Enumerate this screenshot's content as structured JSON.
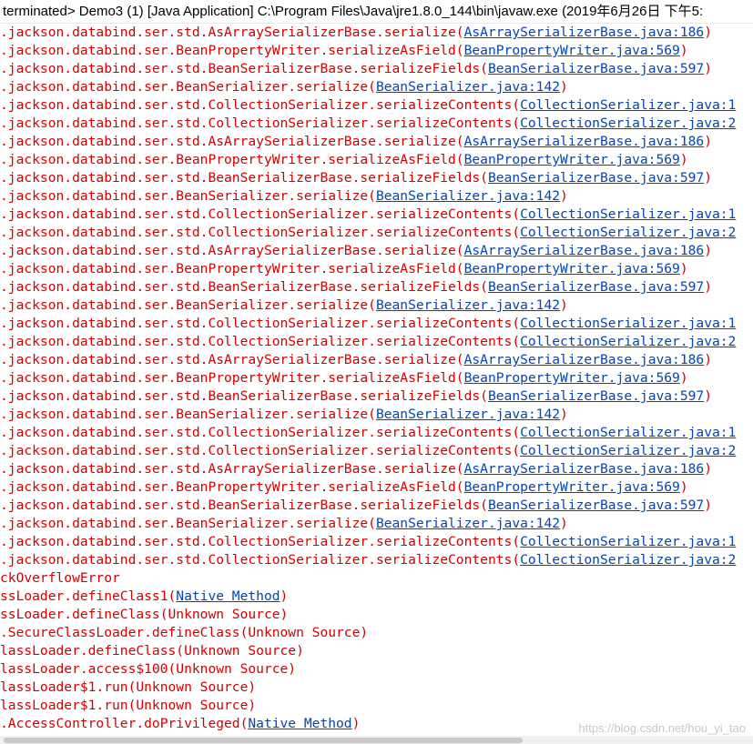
{
  "console": {
    "title": "terminated> Demo3 (1) [Java Application] C:\\Program Files\\Java\\jre1.8.0_144\\bin\\javaw.exe (2019年6月26日 下午5:",
    "watermark": "https://blog.csdn.net/hou_yi_tao",
    "lines": [
      {
        "text": ".jackson.databind.ser.std.AsArraySerializerBase.serialize(",
        "link": "AsArraySerializerBase.java:186",
        "suffix": ")"
      },
      {
        "text": ".jackson.databind.ser.BeanPropertyWriter.serializeAsField(",
        "link": "BeanPropertyWriter.java:569",
        "suffix": ")"
      },
      {
        "text": ".jackson.databind.ser.std.BeanSerializerBase.serializeFields(",
        "link": "BeanSerializerBase.java:597",
        "suffix": ")"
      },
      {
        "text": ".jackson.databind.ser.BeanSerializer.serialize(",
        "link": "BeanSerializer.java:142",
        "suffix": ")"
      },
      {
        "text": ".jackson.databind.ser.std.CollectionSerializer.serializeContents(",
        "link": "CollectionSerializer.java:1",
        "suffix": ""
      },
      {
        "text": ".jackson.databind.ser.std.CollectionSerializer.serializeContents(",
        "link": "CollectionSerializer.java:2",
        "suffix": ""
      },
      {
        "text": ".jackson.databind.ser.std.AsArraySerializerBase.serialize(",
        "link": "AsArraySerializerBase.java:186",
        "suffix": ")"
      },
      {
        "text": ".jackson.databind.ser.BeanPropertyWriter.serializeAsField(",
        "link": "BeanPropertyWriter.java:569",
        "suffix": ")"
      },
      {
        "text": ".jackson.databind.ser.std.BeanSerializerBase.serializeFields(",
        "link": "BeanSerializerBase.java:597",
        "suffix": ")"
      },
      {
        "text": ".jackson.databind.ser.BeanSerializer.serialize(",
        "link": "BeanSerializer.java:142",
        "suffix": ")"
      },
      {
        "text": ".jackson.databind.ser.std.CollectionSerializer.serializeContents(",
        "link": "CollectionSerializer.java:1",
        "suffix": ""
      },
      {
        "text": ".jackson.databind.ser.std.CollectionSerializer.serializeContents(",
        "link": "CollectionSerializer.java:2",
        "suffix": ""
      },
      {
        "text": ".jackson.databind.ser.std.AsArraySerializerBase.serialize(",
        "link": "AsArraySerializerBase.java:186",
        "suffix": ")"
      },
      {
        "text": ".jackson.databind.ser.BeanPropertyWriter.serializeAsField(",
        "link": "BeanPropertyWriter.java:569",
        "suffix": ")"
      },
      {
        "text": ".jackson.databind.ser.std.BeanSerializerBase.serializeFields(",
        "link": "BeanSerializerBase.java:597",
        "suffix": ")"
      },
      {
        "text": ".jackson.databind.ser.BeanSerializer.serialize(",
        "link": "BeanSerializer.java:142",
        "suffix": ")"
      },
      {
        "text": ".jackson.databind.ser.std.CollectionSerializer.serializeContents(",
        "link": "CollectionSerializer.java:1",
        "suffix": ""
      },
      {
        "text": ".jackson.databind.ser.std.CollectionSerializer.serializeContents(",
        "link": "CollectionSerializer.java:2",
        "suffix": ""
      },
      {
        "text": ".jackson.databind.ser.std.AsArraySerializerBase.serialize(",
        "link": "AsArraySerializerBase.java:186",
        "suffix": ")"
      },
      {
        "text": ".jackson.databind.ser.BeanPropertyWriter.serializeAsField(",
        "link": "BeanPropertyWriter.java:569",
        "suffix": ")"
      },
      {
        "text": ".jackson.databind.ser.std.BeanSerializerBase.serializeFields(",
        "link": "BeanSerializerBase.java:597",
        "suffix": ")"
      },
      {
        "text": ".jackson.databind.ser.BeanSerializer.serialize(",
        "link": "BeanSerializer.java:142",
        "suffix": ")"
      },
      {
        "text": ".jackson.databind.ser.std.CollectionSerializer.serializeContents(",
        "link": "CollectionSerializer.java:1",
        "suffix": ""
      },
      {
        "text": ".jackson.databind.ser.std.CollectionSerializer.serializeContents(",
        "link": "CollectionSerializer.java:2",
        "suffix": ""
      },
      {
        "text": ".jackson.databind.ser.std.AsArraySerializerBase.serialize(",
        "link": "AsArraySerializerBase.java:186",
        "suffix": ")"
      },
      {
        "text": ".jackson.databind.ser.BeanPropertyWriter.serializeAsField(",
        "link": "BeanPropertyWriter.java:569",
        "suffix": ")"
      },
      {
        "text": ".jackson.databind.ser.std.BeanSerializerBase.serializeFields(",
        "link": "BeanSerializerBase.java:597",
        "suffix": ")"
      },
      {
        "text": ".jackson.databind.ser.BeanSerializer.serialize(",
        "link": "BeanSerializer.java:142",
        "suffix": ")"
      },
      {
        "text": ".jackson.databind.ser.std.CollectionSerializer.serializeContents(",
        "link": "CollectionSerializer.java:1",
        "suffix": ""
      },
      {
        "text": ".jackson.databind.ser.std.CollectionSerializer.serializeContents(",
        "link": "CollectionSerializer.java:2",
        "suffix": ""
      },
      {
        "text": "ckOverflowError",
        "link": "",
        "suffix": ""
      },
      {
        "text": "ssLoader.defineClass1(",
        "link": "Native Method",
        "suffix": ")"
      },
      {
        "text": "ssLoader.defineClass(Unknown Source)",
        "link": "",
        "suffix": ""
      },
      {
        "text": ".SecureClassLoader.defineClass(Unknown Source)",
        "link": "",
        "suffix": ""
      },
      {
        "text": "lassLoader.defineClass(Unknown Source)",
        "link": "",
        "suffix": ""
      },
      {
        "text": "lassLoader.access$100(Unknown Source)",
        "link": "",
        "suffix": ""
      },
      {
        "text": "lassLoader$1.run(Unknown Source)",
        "link": "",
        "suffix": ""
      },
      {
        "text": "lassLoader$1.run(Unknown Source)",
        "link": "",
        "suffix": ""
      },
      {
        "text": ".AccessController.doPrivileged(",
        "link": "Native Method",
        "suffix": ")"
      }
    ]
  }
}
